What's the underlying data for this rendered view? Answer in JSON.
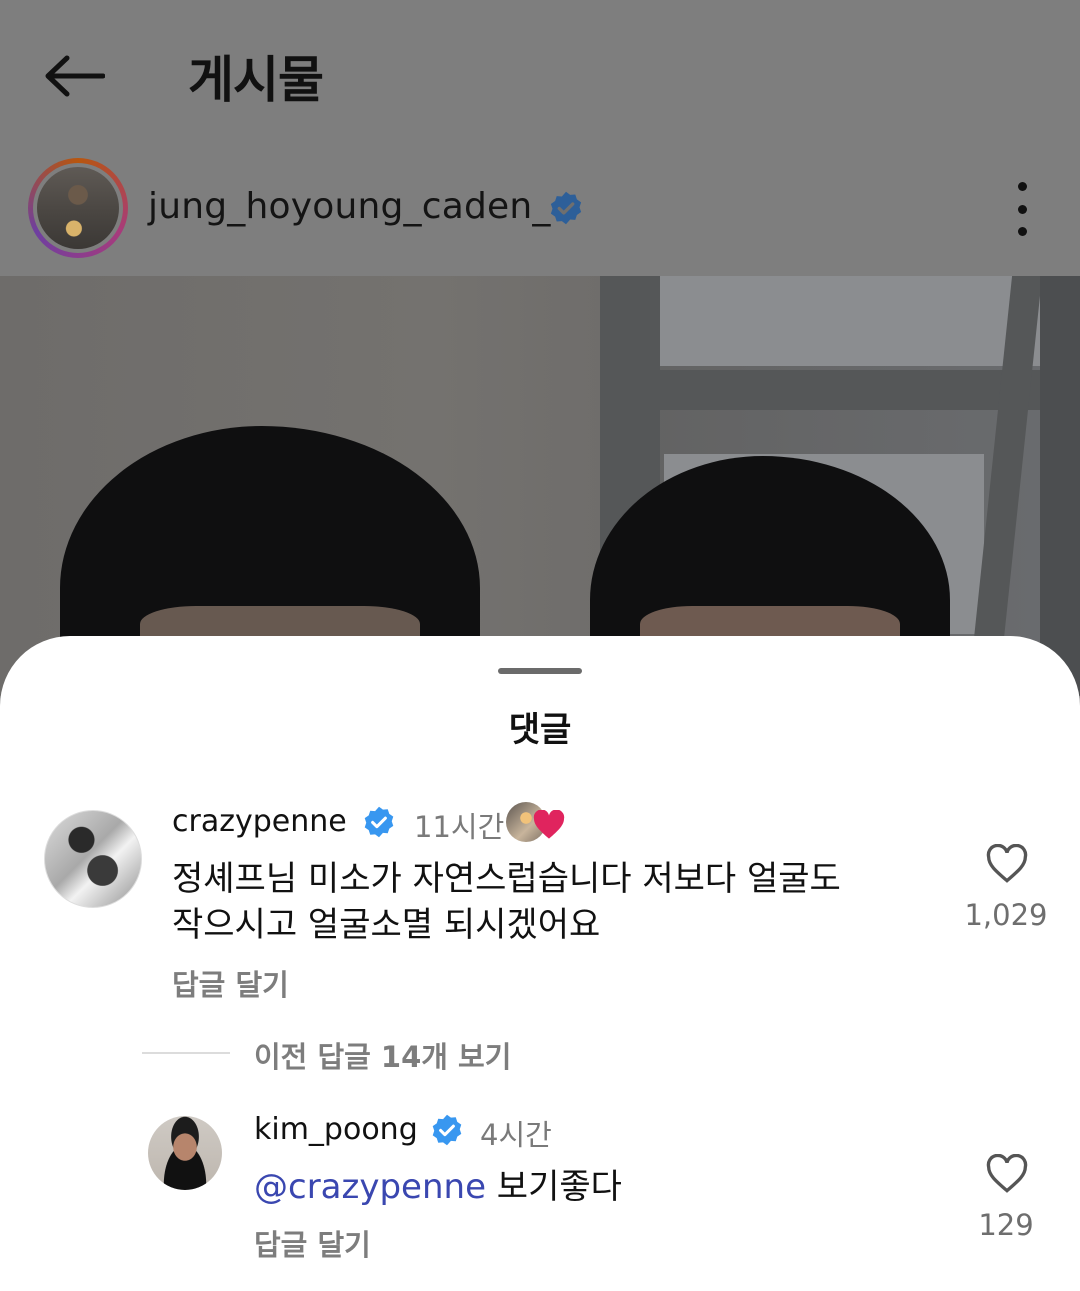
{
  "header": {
    "title": "게시물",
    "back_icon": "arrow-left-icon",
    "more_icon": "more-vertical-icon"
  },
  "post": {
    "author": "jung_hoyoung_caden_",
    "verified": true
  },
  "comments_sheet": {
    "title": "댓글",
    "comments": [
      {
        "username": "crazypenne",
        "verified": true,
        "time": "11시간",
        "text_line1": "정셰프님 미소가 자연스럽습니다 저보다 얼굴도",
        "text_line2": "작으시고 얼굴소멸 되시겠어요",
        "reply_label": "답글 달기",
        "likes": "1,029",
        "liked_by_author": true
      }
    ],
    "view_previous_replies": "이전 답글 14개 보기",
    "replies": [
      {
        "username": "kim_poong",
        "verified": true,
        "time": "4시간",
        "mention": "@crazypenne",
        "text": " 보기좋다",
        "reply_label": "답글 달기",
        "likes": "129"
      }
    ]
  },
  "colors": {
    "verified": "#3897f0",
    "mention": "#3a47b0",
    "liked_heart": "#e0245e",
    "dim_overlay": "#7e7e7e"
  }
}
